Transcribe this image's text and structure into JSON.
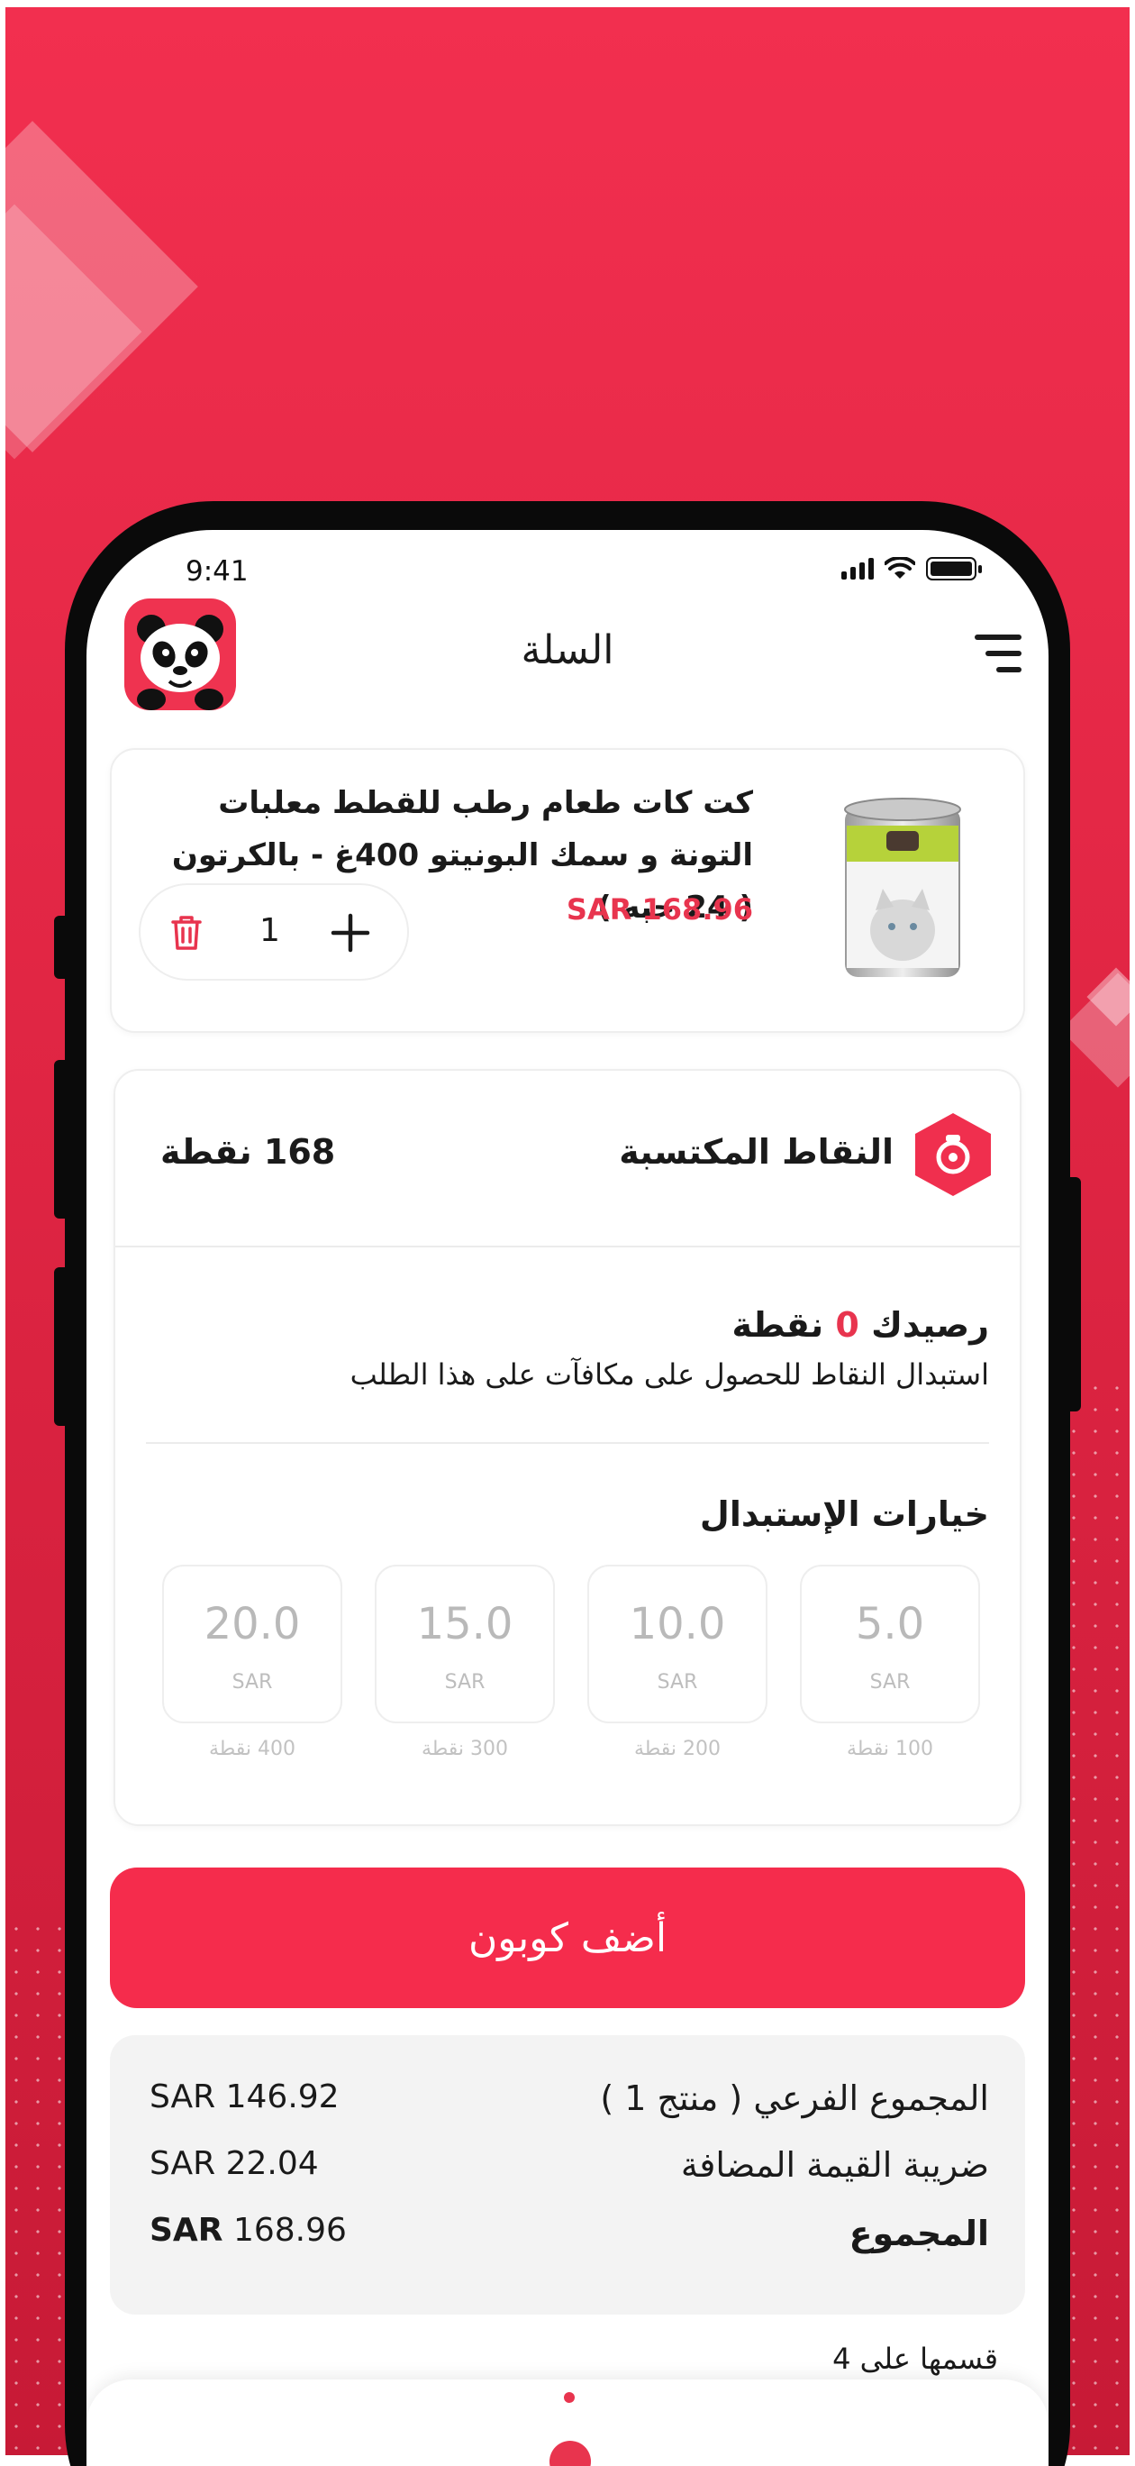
{
  "status_bar": {
    "time": "9:41"
  },
  "header": {
    "title": "السلة"
  },
  "cart_item": {
    "name": "كت كات طعام رطب للقطط معلبات التونة و سمك البونيتو 400غ - بالكرتون ( 24 حبه )",
    "price": "SAR 168.96",
    "quantity": "1"
  },
  "points": {
    "title": "النقاط المكتسبة",
    "earned": "168 نقطة",
    "balance_prefix": "رصيدك",
    "balance_value": "0",
    "balance_suffix": "نقطة",
    "description": "استبدال النقاط للحصول على مكافآت على هذا الطلب",
    "options_title": "خيارات الإستبدال",
    "options": [
      {
        "amount": "5.0",
        "currency": "SAR",
        "points": "100 نقطة"
      },
      {
        "amount": "10.0",
        "currency": "SAR",
        "points": "200 نقطة"
      },
      {
        "amount": "15.0",
        "currency": "SAR",
        "points": "300 نقطة"
      },
      {
        "amount": "20.0",
        "currency": "SAR",
        "points": "400 نقطة"
      }
    ]
  },
  "coupon_button": "أضف كوبون",
  "totals": {
    "subtotal_label": "المجموع الفرعي ( منتج 1 )",
    "subtotal_value": "SAR 146.92",
    "vat_label": "ضريبة القيمة المضافة",
    "vat_value": "SAR 22.04",
    "total_label": "المجموع",
    "total_currency": "SAR",
    "total_amount": "168.96"
  },
  "installments_text": "قسمها على 4",
  "colors": {
    "brand": "#f52c4c",
    "price": "#e8344e"
  },
  "icons": [
    "panda-logo-icon",
    "menu-icon",
    "trash-icon",
    "plus-icon",
    "points-badge-icon",
    "signal-icon",
    "wifi-icon",
    "battery-icon"
  ]
}
